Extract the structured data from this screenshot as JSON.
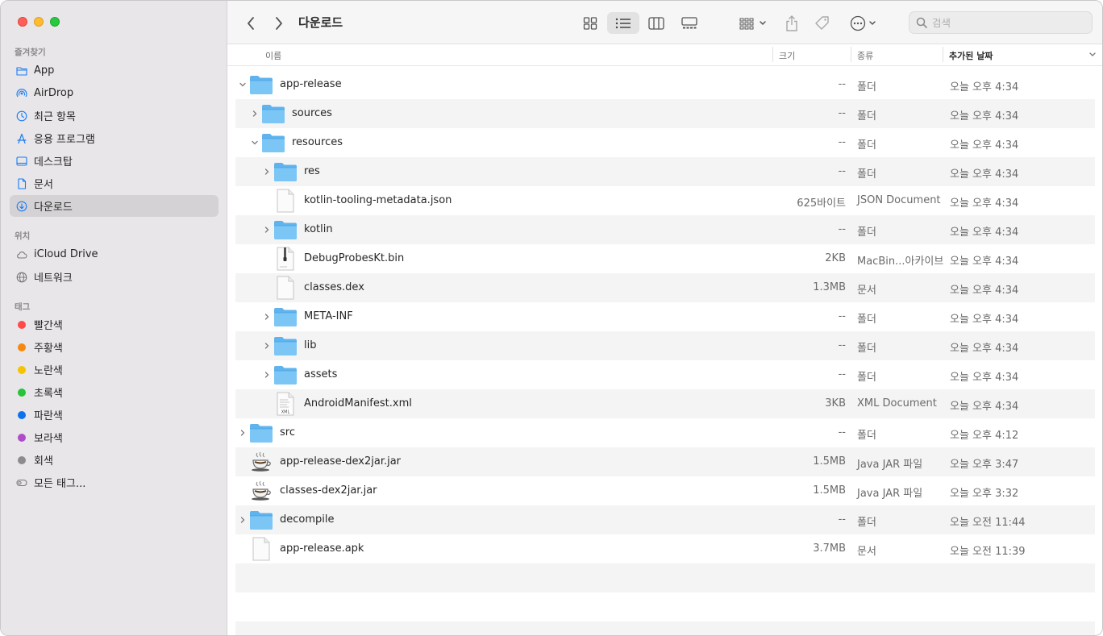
{
  "window": {
    "title": "다운로드"
  },
  "sidebar": {
    "favorites_header": "즐겨찾기",
    "favorites": [
      {
        "label": "App",
        "icon": "folder-icon"
      },
      {
        "label": "AirDrop",
        "icon": "airdrop-icon"
      },
      {
        "label": "최근 항목",
        "icon": "clock-icon"
      },
      {
        "label": "응용 프로그램",
        "icon": "applications-icon"
      },
      {
        "label": "데스크탑",
        "icon": "desktop-icon"
      },
      {
        "label": "문서",
        "icon": "document-icon"
      },
      {
        "label": "다운로드",
        "icon": "download-icon",
        "selected": true
      }
    ],
    "locations_header": "위치",
    "locations": [
      {
        "label": "iCloud Drive",
        "icon": "cloud-icon"
      },
      {
        "label": "네트워크",
        "icon": "network-icon"
      }
    ],
    "tags_header": "태그",
    "tags": [
      {
        "label": "빨간색",
        "color": "#fe4a49"
      },
      {
        "label": "주황색",
        "color": "#f7880f"
      },
      {
        "label": "노란색",
        "color": "#f5c400"
      },
      {
        "label": "초록색",
        "color": "#26c33b"
      },
      {
        "label": "파란색",
        "color": "#0a72ee"
      },
      {
        "label": "보라색",
        "color": "#b04cc8"
      },
      {
        "label": "회색",
        "color": "#8c8c8c"
      }
    ],
    "all_tags": "모든 태그..."
  },
  "toolbar": {
    "back_icon": "chevron-left-icon",
    "forward_icon": "chevron-right-icon",
    "search_placeholder": "검색"
  },
  "columns": {
    "name": "이름",
    "size": "크기",
    "kind": "종류",
    "date_added": "추가된 날짜"
  },
  "files": [
    {
      "name": "app-release",
      "size": "--",
      "kind": "폴더",
      "date": "오늘 오후 4:34",
      "type": "folder",
      "level": 0,
      "disclosure": "open"
    },
    {
      "name": "sources",
      "size": "--",
      "kind": "폴더",
      "date": "오늘 오후 4:34",
      "type": "folder",
      "level": 1,
      "disclosure": "closed"
    },
    {
      "name": "resources",
      "size": "--",
      "kind": "폴더",
      "date": "오늘 오후 4:34",
      "type": "folder",
      "level": 1,
      "disclosure": "open"
    },
    {
      "name": "res",
      "size": "--",
      "kind": "폴더",
      "date": "오늘 오후 4:34",
      "type": "folder",
      "level": 2,
      "disclosure": "closed"
    },
    {
      "name": "kotlin-tooling-metadata.json",
      "size": "625바이트",
      "kind": "JSON Document",
      "date": "오늘 오후 4:34",
      "type": "doc",
      "level": 2,
      "disclosure": "none"
    },
    {
      "name": "kotlin",
      "size": "--",
      "kind": "폴더",
      "date": "오늘 오후 4:34",
      "type": "folder",
      "level": 2,
      "disclosure": "closed"
    },
    {
      "name": "DebugProbesKt.bin",
      "size": "2KB",
      "kind": "MacBin...아카이브",
      "date": "오늘 오후 4:34",
      "type": "bin",
      "level": 2,
      "disclosure": "none"
    },
    {
      "name": "classes.dex",
      "size": "1.3MB",
      "kind": "문서",
      "date": "오늘 오후 4:34",
      "type": "doc",
      "level": 2,
      "disclosure": "none"
    },
    {
      "name": "META-INF",
      "size": "--",
      "kind": "폴더",
      "date": "오늘 오후 4:34",
      "type": "folder",
      "level": 2,
      "disclosure": "closed"
    },
    {
      "name": "lib",
      "size": "--",
      "kind": "폴더",
      "date": "오늘 오후 4:34",
      "type": "folder",
      "level": 2,
      "disclosure": "closed"
    },
    {
      "name": "assets",
      "size": "--",
      "kind": "폴더",
      "date": "오늘 오후 4:34",
      "type": "folder",
      "level": 2,
      "disclosure": "closed"
    },
    {
      "name": "AndroidManifest.xml",
      "size": "3KB",
      "kind": "XML Document",
      "date": "오늘 오후 4:34",
      "type": "xml",
      "level": 2,
      "disclosure": "none"
    },
    {
      "name": "src",
      "size": "--",
      "kind": "폴더",
      "date": "오늘 오후 4:12",
      "type": "folder",
      "level": 0,
      "disclosure": "closed"
    },
    {
      "name": "app-release-dex2jar.jar",
      "size": "1.5MB",
      "kind": "Java JAR 파일",
      "date": "오늘 오후 3:47",
      "type": "jar",
      "level": 0,
      "disclosure": "none"
    },
    {
      "name": "classes-dex2jar.jar",
      "size": "1.5MB",
      "kind": "Java JAR 파일",
      "date": "오늘 오후 3:32",
      "type": "jar",
      "level": 0,
      "disclosure": "none"
    },
    {
      "name": "decompile",
      "size": "--",
      "kind": "폴더",
      "date": "오늘 오전 11:44",
      "type": "folder",
      "level": 0,
      "disclosure": "closed"
    },
    {
      "name": "app-release.apk",
      "size": "3.7MB",
      "kind": "문서",
      "date": "오늘 오전 11:39",
      "type": "doc",
      "level": 0,
      "disclosure": "none"
    }
  ]
}
